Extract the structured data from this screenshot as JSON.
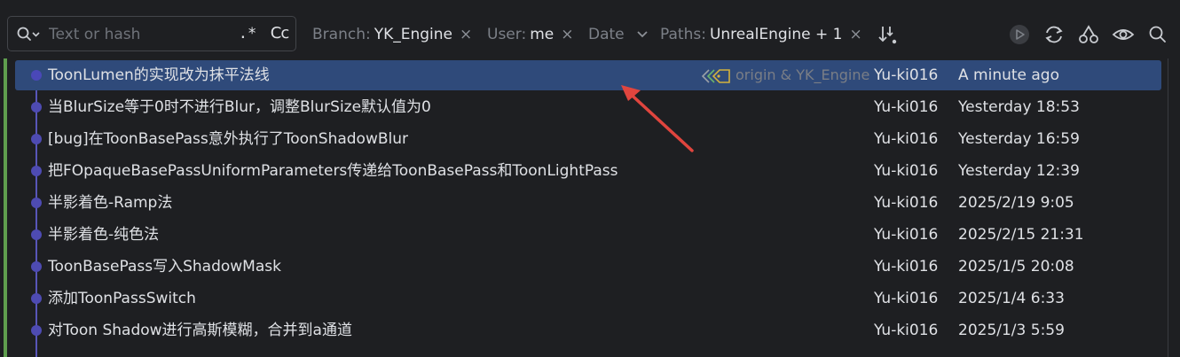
{
  "toolbar": {
    "search": {
      "placeholder": "Text or hash",
      "value": "",
      "regex_label": ".*",
      "case_label": "Cc"
    },
    "filters": {
      "branch": {
        "label": "Branch:",
        "value": "YK_Engine",
        "clear": "×"
      },
      "user": {
        "label": "User:",
        "value": "me",
        "clear": "×"
      },
      "date": {
        "label": "Date"
      },
      "paths": {
        "label": "Paths:",
        "value": "UnrealEngine + 1",
        "clear": "×"
      }
    },
    "icons": [
      "search-history-icon",
      "sort-icon",
      "run-icon",
      "refresh-icon",
      "cherry-pick-icon",
      "eye-icon",
      "search-icon"
    ]
  },
  "commits": [
    {
      "message": "ToonLumen的实现改为抹平法线",
      "refs": "origin & YK_Engine",
      "author": "Yu-ki016",
      "date": "A minute ago",
      "selected": true
    },
    {
      "message": "当BlurSize等于0时不进行Blur，调整BlurSize默认值为0",
      "refs": "",
      "author": "Yu-ki016",
      "date": "Yesterday 18:53",
      "selected": false
    },
    {
      "message": "[bug]在ToonBasePass意外执行了ToonShadowBlur",
      "refs": "",
      "author": "Yu-ki016",
      "date": "Yesterday 16:59",
      "selected": false
    },
    {
      "message": "把FOpaqueBasePassUniformParameters传递给ToonBasePass和ToonLightPass",
      "refs": "",
      "author": "Yu-ki016",
      "date": "Yesterday 12:39",
      "selected": false
    },
    {
      "message": "半影着色-Ramp法",
      "refs": "",
      "author": "Yu-ki016",
      "date": "2025/2/19 9:05",
      "selected": false
    },
    {
      "message": "半影着色-纯色法",
      "refs": "",
      "author": "Yu-ki016",
      "date": "2025/2/15 21:31",
      "selected": false
    },
    {
      "message": "ToonBasePass写入ShadowMask",
      "refs": "",
      "author": "Yu-ki016",
      "date": "2025/1/5 20:08",
      "selected": false
    },
    {
      "message": "添加ToonPassSwitch",
      "refs": "",
      "author": "Yu-ki016",
      "date": "2025/1/4 6:33",
      "selected": false
    },
    {
      "message": "对Toon Shadow进行高斯模糊，合并到a通道",
      "refs": "",
      "author": "Yu-ki016",
      "date": "2025/1/3 5:59",
      "selected": false
    }
  ],
  "colors": {
    "selection": "#2f4a7a",
    "graph": "#4e4bb2",
    "branch_bar": "#5f9e4e",
    "annotation_arrow": "#e0453e"
  }
}
